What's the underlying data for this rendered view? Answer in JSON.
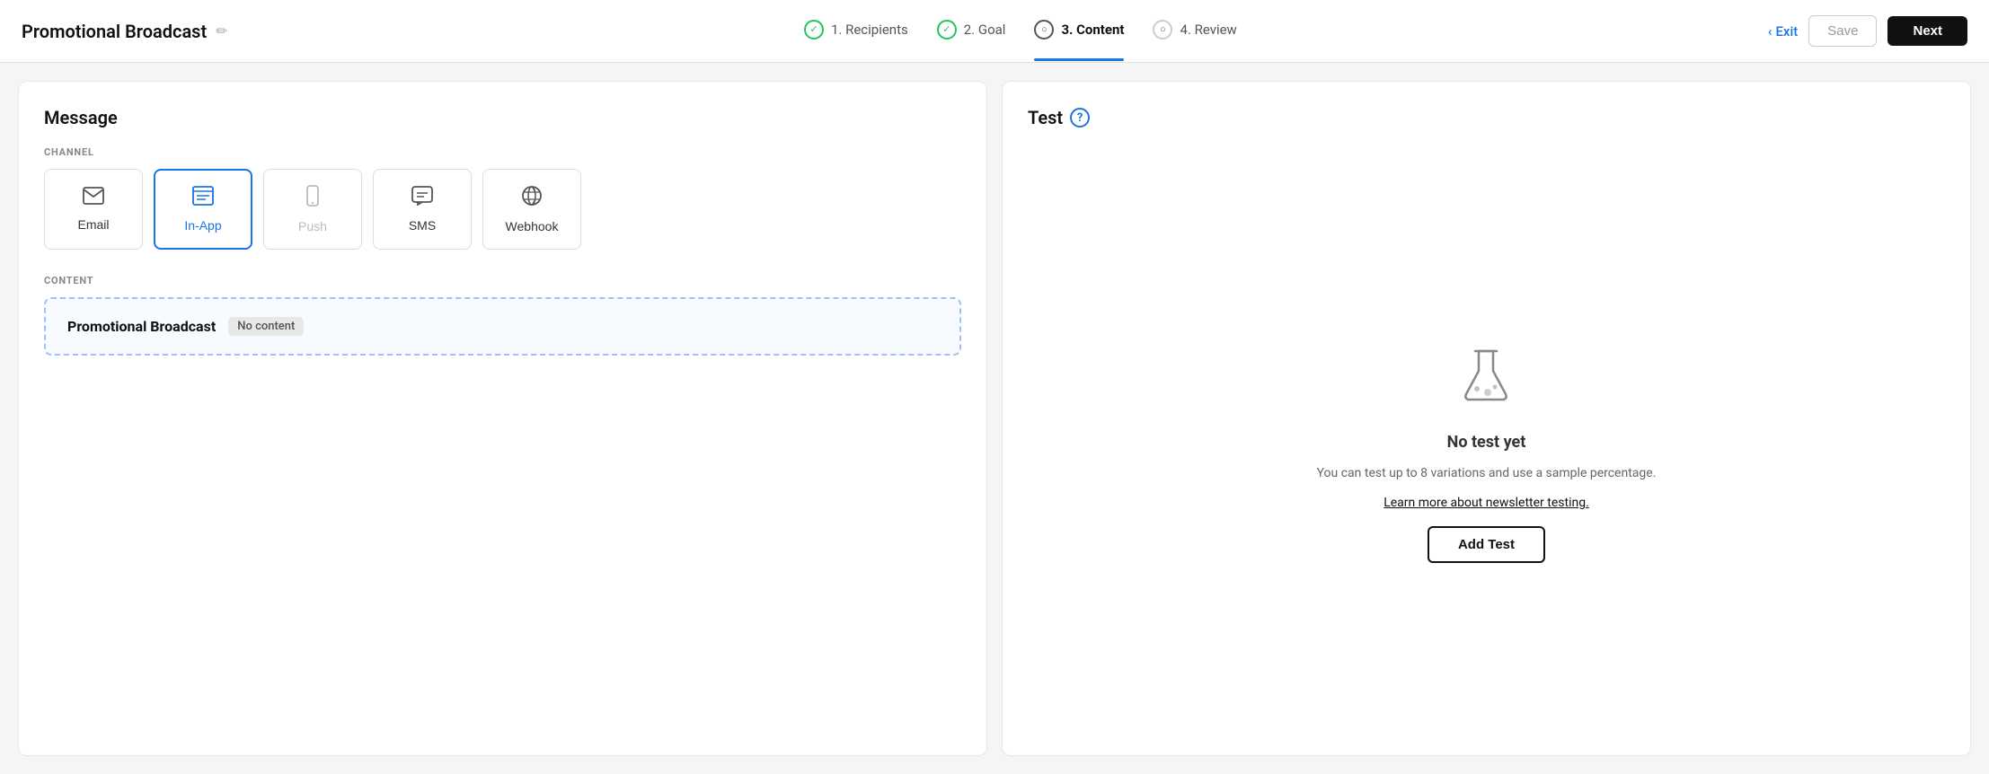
{
  "header": {
    "title": "Promotional Broadcast",
    "edit_icon": "✏",
    "exit_label": "Exit",
    "save_label": "Save",
    "next_label": "Next",
    "back_arrow": "‹"
  },
  "steps": [
    {
      "id": "recipients",
      "number": "1.",
      "label": "Recipients",
      "status": "done"
    },
    {
      "id": "goal",
      "number": "2.",
      "label": "Goal",
      "status": "done"
    },
    {
      "id": "content",
      "number": "3.",
      "label": "Content",
      "status": "active"
    },
    {
      "id": "review",
      "number": "4.",
      "label": "Review",
      "status": "pending"
    }
  ],
  "left_panel": {
    "title": "Message",
    "channel_label": "CHANNEL",
    "channels": [
      {
        "id": "email",
        "label": "Email",
        "icon": "✉",
        "selected": false,
        "disabled": false
      },
      {
        "id": "inapp",
        "label": "In-App",
        "icon": "▤",
        "selected": true,
        "disabled": false
      },
      {
        "id": "push",
        "label": "Push",
        "icon": "📱",
        "selected": false,
        "disabled": true
      },
      {
        "id": "sms",
        "label": "SMS",
        "icon": "💬",
        "selected": false,
        "disabled": false
      },
      {
        "id": "webhook",
        "label": "Webhook",
        "icon": "🌐",
        "selected": false,
        "disabled": false
      }
    ],
    "content_label": "CONTENT",
    "content_item": {
      "title": "Promotional Broadcast",
      "badge": "No content"
    }
  },
  "right_panel": {
    "title": "Test",
    "help_icon": "?",
    "no_test_title": "No test yet",
    "no_test_desc": "You can test up to 8 variations and use a sample percentage.",
    "learn_more_text": "Learn more about newsletter testing.",
    "add_test_label": "Add Test"
  }
}
